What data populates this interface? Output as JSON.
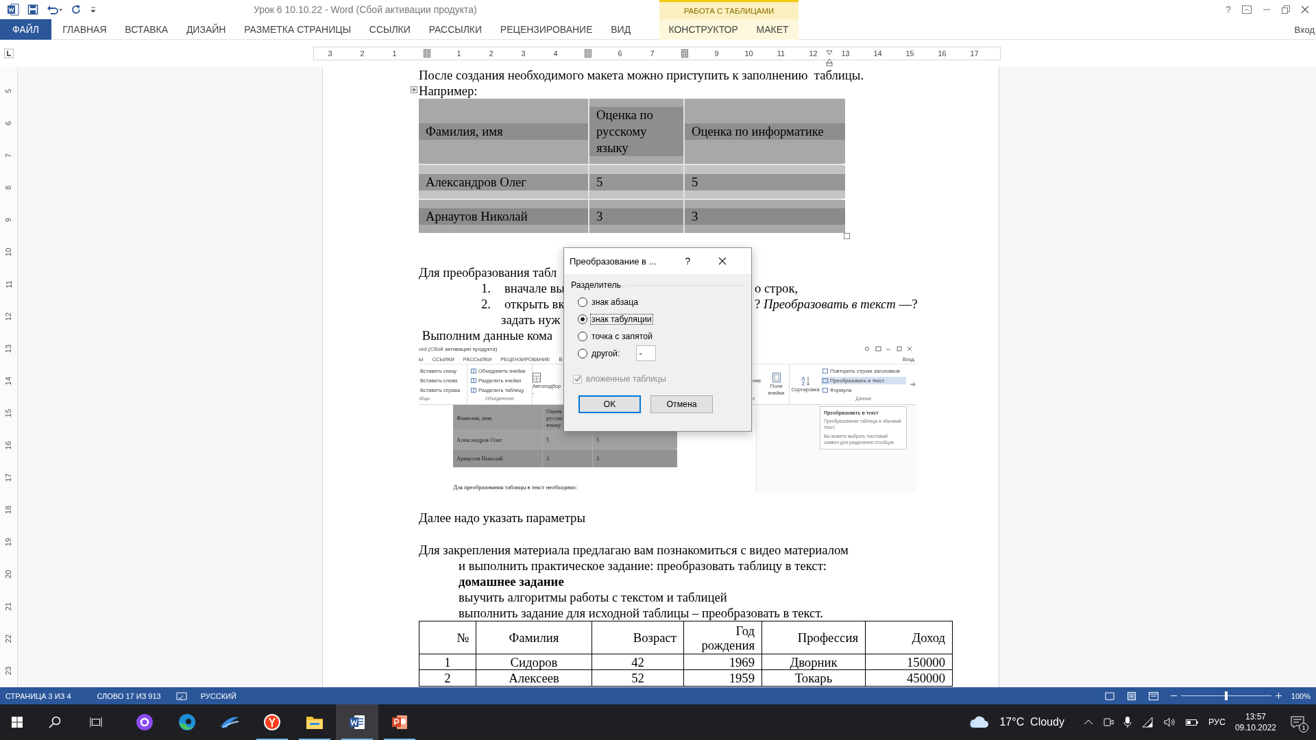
{
  "window": {
    "title": "Урок 6 10.10.22 - Word (Сбой активации продукта)",
    "contextual_label": "РАБОТА С ТАБЛИЦАМИ",
    "help": "?",
    "signin": "Вход"
  },
  "ribbon_tabs": [
    {
      "label": "ФАЙЛ",
      "kind": "file"
    },
    {
      "label": "ГЛАВНАЯ",
      "kind": "normal"
    },
    {
      "label": "ВСТАВКА",
      "kind": "normal"
    },
    {
      "label": "ДИЗАЙН",
      "kind": "normal"
    },
    {
      "label": "РАЗМЕТКА СТРАНИЦЫ",
      "kind": "normal"
    },
    {
      "label": "ССЫЛКИ",
      "kind": "normal"
    },
    {
      "label": "РАССЫЛКИ",
      "kind": "normal"
    },
    {
      "label": "РЕЦЕНЗИРОВАНИЕ",
      "kind": "normal"
    },
    {
      "label": "ВИД",
      "kind": "normal"
    },
    {
      "label": "КОНСТРУКТОР",
      "kind": "contextual"
    },
    {
      "label": "МАКЕТ",
      "kind": "contextual"
    }
  ],
  "ruler": [
    {
      "kind": "number",
      "label": "3"
    },
    {
      "kind": "number",
      "label": "2"
    },
    {
      "kind": "number",
      "label": "1"
    },
    {
      "kind": "column_marker"
    },
    {
      "kind": "number",
      "label": "1"
    },
    {
      "kind": "number",
      "label": "2"
    },
    {
      "kind": "number",
      "label": "3"
    },
    {
      "kind": "number",
      "label": "4"
    },
    {
      "kind": "column_marker"
    },
    {
      "kind": "number",
      "label": "6"
    },
    {
      "kind": "number",
      "label": "7"
    },
    {
      "kind": "column_marker"
    },
    {
      "kind": "number",
      "label": "9"
    },
    {
      "kind": "number",
      "label": "10"
    },
    {
      "kind": "number",
      "label": "11"
    },
    {
      "kind": "number",
      "label": "12"
    },
    {
      "kind": "indent_marker"
    },
    {
      "kind": "number",
      "label": "13"
    },
    {
      "kind": "number",
      "label": "14"
    },
    {
      "kind": "number",
      "label": "15"
    },
    {
      "kind": "number",
      "label": "16"
    },
    {
      "kind": "number",
      "label": "17"
    }
  ],
  "vertical_ruler": [
    "5",
    "6",
    "7",
    "8",
    "9",
    "10",
    "11",
    "12",
    "13",
    "14",
    "15",
    "16",
    "17",
    "18",
    "19",
    "20",
    "21",
    "22",
    "23"
  ],
  "document": {
    "intro": "После создания необходимого макета можно приступить к заполнению  таблицы.",
    "example_label": "Например:",
    "grade_table": {
      "columns": [
        "Фамилия, имя",
        "Оценка по русскому языку",
        "Оценка по информатике"
      ],
      "rows": [
        [
          "Александров Олег",
          "5",
          "5"
        ],
        [
          "Арнаутов Николай",
          "3",
          "3"
        ]
      ]
    },
    "steps_intro": "Для преобразования табл",
    "steps": [
      {
        "number": "1.",
        "left": "вначале вы",
        "right": "о строк,"
      },
      {
        "number": "2.",
        "left": "открыть вк",
        "right": "? *Преобразовать в текст* —?"
      }
    ],
    "steps_tail": "задать нуж",
    "run_line": " Выполним данные кома",
    "embedded_screenshot": {
      "title": "ord (Сбой активации продукта)",
      "tabs": [
        "Ы",
        "ССЫЛКИ",
        "РАССЫЛКИ",
        "РЕЦЕНЗИРОВАНИЕ",
        "В"
      ],
      "signin": "Вход",
      "rows_group": {
        "items": [
          "Вставить снизу",
          "Вставить слева",
          "Вставить справа"
        ],
        "label": "лбцы"
      },
      "merge_group": {
        "items": [
          "Объединить ячейки",
          "Разделить ячейки",
          "Разделить таблицу"
        ],
        "label": "Объединение"
      },
      "autofit": {
        "label": "Автоподбор",
        "caret": "-"
      },
      "cut_group": {
        "label": "ние",
        "group_label": "е"
      },
      "cell_margins": [
        "Поля",
        "ячейки"
      ],
      "sort": "Сортировка",
      "data_group": {
        "items": [
          {
            "label": "Повторить строки заголовков",
            "selected": false
          },
          {
            "label": "Преобразовать в текст",
            "selected": true
          },
          {
            "label": "Формула",
            "selected": false
          }
        ],
        "label": "Данные"
      },
      "table": {
        "header": [
          "Фамилия, имя",
          "Оценк\nрусско\nязыку"
        ],
        "rows": [
          [
            "Александров Олег",
            "5",
            "5"
          ],
          [
            "Арнаутов Николай",
            "3",
            "3"
          ]
        ]
      },
      "text": "Для преобразования таблицы в текст необходимо:",
      "tooltip": {
        "title": "Преобразовать в текст",
        "lines": [
          "Преобразование таблицы в обычный текст.",
          "Вы можете выбрать текстовый символ для разделения столбцов."
        ]
      }
    },
    "after": "Далее надо указать параметры",
    "closing": [
      {
        "text": "Для закрепления материала предлагаю вам познакомиться с видео материалом",
        "kind": "first"
      },
      {
        "text": "и выполнить практическое задание: преобразовать таблицу в текст:",
        "kind": "indented"
      },
      {
        "text": "домашнее задание",
        "kind": "heading"
      },
      {
        "text": "выучить алгоритмы работы с текстом и таблицей",
        "kind": "indented"
      },
      {
        "text": "выполнить задание для исходной таблицы – преобразовать в текст.",
        "kind": "indented"
      }
    ],
    "people_table": {
      "columns": [
        "№",
        "Фамилия",
        "Возраст",
        "Год рождения",
        "Профессия",
        "Доход"
      ],
      "rows": [
        [
          "1",
          "Сидоров",
          "42",
          "1969",
          "Дворник",
          "150000"
        ],
        [
          "2",
          "Алексеев",
          "52",
          "1959",
          "Токарь",
          "450000"
        ]
      ]
    }
  },
  "dialog": {
    "title": "Преобразование в ...",
    "help": "?",
    "group": "Разделитель",
    "options": [
      {
        "label": "знак абзаца",
        "selected": false
      },
      {
        "label": "знак табуляции",
        "selected": true
      },
      {
        "label": "точка с запятой",
        "selected": false
      },
      {
        "label": "другой:",
        "selected": false
      }
    ],
    "other_value": "-",
    "nested": {
      "label": "вложенные таблицы",
      "checked": true,
      "disabled": true
    },
    "buttons": [
      {
        "label": "OK",
        "kind": "default"
      },
      {
        "label": "Отмена",
        "kind": "normal"
      }
    ]
  },
  "status_bar": {
    "page": "СТРАНИЦА 3 ИЗ 4",
    "words": "СЛОВО 17 ИЗ 913",
    "language": "РУССКИЙ",
    "zoom": {
      "level": 0.5,
      "reading": "100%"
    }
  },
  "taskbar": {
    "apps": [
      {
        "kind": "assistant",
        "running": false,
        "selected": false
      },
      {
        "kind": "edge",
        "running": false,
        "selected": false
      },
      {
        "kind": "swoosh",
        "running": false,
        "selected": false
      },
      {
        "kind": "yandex",
        "running": true,
        "selected": false
      },
      {
        "kind": "explorer",
        "running": true,
        "selected": false
      },
      {
        "kind": "word",
        "running": true,
        "selected": true
      },
      {
        "kind": "powerpoint",
        "running": true,
        "selected": false
      }
    ],
    "weather": "17°C  Cloudy",
    "language": "РУС",
    "time": "13:57",
    "date": "09.10.2022",
    "notifications": "1"
  }
}
